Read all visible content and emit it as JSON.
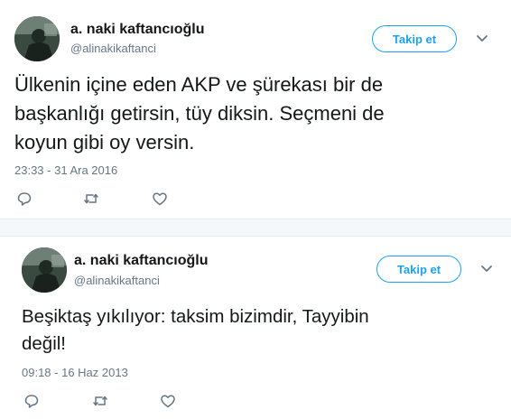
{
  "tweets": [
    {
      "author": {
        "name": "a. naki kaftancıoğlu",
        "handle": "@alinakikaftanci"
      },
      "follow_label": "Takip et",
      "text": "Ülkenin içine eden AKP ve şürekası bir de\nbaşkanlığı getirsin, tüy diksin. Seçmeni de\nkoyun gibi oy versin.",
      "timestamp": "23:33 - 31 Ara 2016",
      "actions": [
        "reply-icon",
        "retweet-icon",
        "like-icon"
      ]
    },
    {
      "author": {
        "name": "a. naki kaftancıoğlu",
        "handle": "@alinakikaftanci"
      },
      "follow_label": "Takip et",
      "text": "Beşiktaş yıkılıyor: taksim bizimdir, Tayyibin\ndeğil!",
      "timestamp": "09:18 - 16 Haz 2013",
      "actions": [
        "reply-icon",
        "retweet-icon",
        "like-icon"
      ]
    }
  ],
  "colors": {
    "accent": "#1da1f2",
    "secondary_text": "#657786",
    "primary_text": "#14171a",
    "icon": "#657786"
  }
}
